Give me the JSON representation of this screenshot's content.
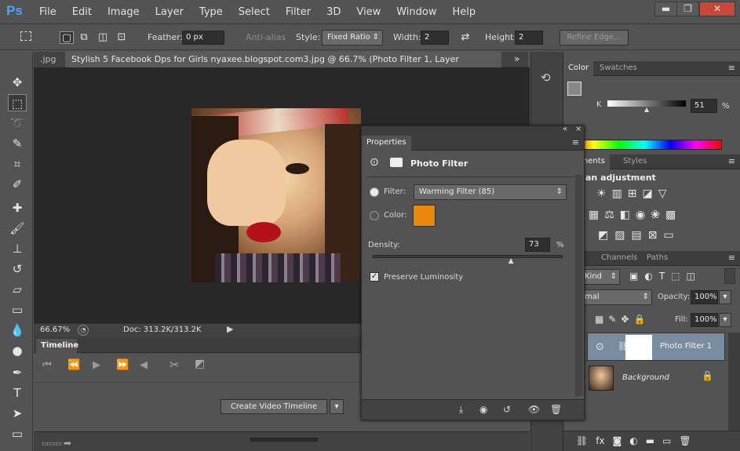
{
  "app": {
    "logo": "Ps"
  },
  "menu": [
    "File",
    "Edit",
    "Image",
    "Layer",
    "Type",
    "Select",
    "Filter",
    "3D",
    "View",
    "Window",
    "Help"
  ],
  "window_controls": {
    "minimize": "▬",
    "restore": "❐",
    "close": "✕"
  },
  "options": {
    "feather_label": "Feather:",
    "feather_value": "0 px",
    "antialias_label": "Anti-alias",
    "style_label": "Style:",
    "style_value": "Fixed Ratio",
    "width_label": "Width:",
    "width_value": "2",
    "height_label": "Height:",
    "height_value": "2",
    "refine_edge": "Refine Edge..."
  },
  "tabs": {
    "prev": ".jpg",
    "active": "Stylish 5 Facebook Dps for Girls nyaxee.blogspot.com3.jpg @ 66.7% (Photo Filter 1, Layer Mask/8) *",
    "close": "×",
    "more": "»"
  },
  "status": {
    "zoom": "66.67%",
    "doc": "Doc: 313.2K/313.2K"
  },
  "timeline": {
    "tab": "Timeline",
    "create_button": "Create Video Timeline"
  },
  "properties": {
    "title": "Properties",
    "adjustment": "Photo Filter",
    "filter_label": "Filter:",
    "filter_value": "Warming Filter (85)",
    "color_label": "Color:",
    "color_swatch": "#e8870a",
    "density_label": "Density:",
    "density_value": "73",
    "density_unit": "%",
    "density_level": 0.73,
    "preserve_label": "Preserve Luminosity"
  },
  "color_panel": {
    "tab_color": "Color",
    "tab_swatches": "Swatches",
    "k_label": "K",
    "k_value": "51",
    "k_unit": "%",
    "k_level": 0.51
  },
  "adjust_panel": {
    "tab_adjust": "ustments",
    "tab_styles": "Styles",
    "heading": "an adjustment"
  },
  "layers_panel": {
    "tab_layers": "rs",
    "tab_channels": "Channels",
    "tab_paths": "Paths",
    "kind": "Kind",
    "blend": "mal",
    "opacity_label": "Opacity:",
    "opacity_value": "100%",
    "fill_label": "Fill:",
    "fill_value": "100%",
    "layers": [
      {
        "name": "Photo Filter 1"
      },
      {
        "name": "Background"
      }
    ]
  }
}
